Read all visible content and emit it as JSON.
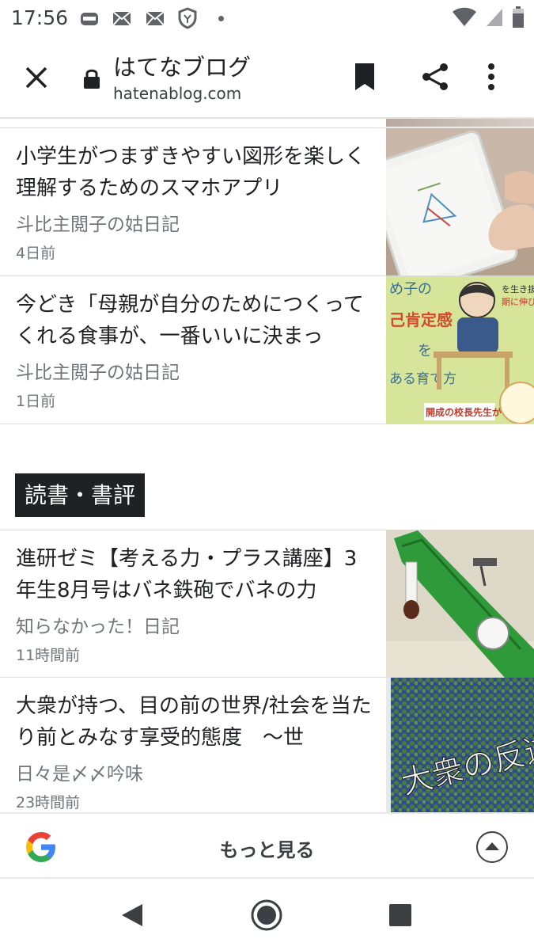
{
  "status_bar": {
    "time": "17:56",
    "left_icons": [
      "aeon-app-icon",
      "mail-icon",
      "mail-icon",
      "shield-icon",
      "dot-icon"
    ],
    "right_icons": [
      "wifi-icon",
      "signal-icon",
      "battery-icon"
    ]
  },
  "toolbar": {
    "title": "はてなブログ",
    "domain": "hatenablog.com",
    "icons": [
      "close-icon",
      "lock-icon",
      "bookmark-icon",
      "share-icon",
      "more-vert-icon"
    ]
  },
  "articles_top": [
    {
      "title": "小学生がつまずきやすい図形を楽しく理解するためのスマホアプリ",
      "source": "斗比主閲子の姑日記",
      "time": "4日前"
    },
    {
      "title": "今どき「母親が自分のためにつくってくれる食事が、一番いいに決まっ",
      "source": "斗比主閲子の姑日記",
      "time": "1日前"
    }
  ],
  "section": {
    "label": "読書・書評"
  },
  "articles_bottom": [
    {
      "title": "進研ゼミ【考える力・プラス講座】3年生8月号はバネ鉄砲でバネの力",
      "source": "知らなかった！日記",
      "time": "11時間前"
    },
    {
      "title": "大衆が持つ、目の前の世界/社会を当たり前とみなす享受的態度　～世",
      "source": "日々是〆〆吟味",
      "time": "23時間前"
    }
  ],
  "thumb_text": {
    "book1_lines": [
      "め子の",
      "己肯定感",
      "を",
      "ある育て方"
    ],
    "book1_side": [
      "を生き抜く力は",
      "期に伸びる！"
    ],
    "book1_badge": "開成の校長先生が",
    "book2_title": "大衆の反逆"
  },
  "bottom_bar": {
    "more_label": "もっと見る"
  },
  "colors": {
    "chip_bg": "#202124",
    "text_primary": "#202124",
    "text_secondary": "#70757a"
  }
}
